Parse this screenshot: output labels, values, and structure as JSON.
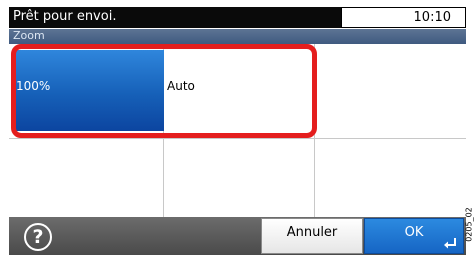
{
  "status": {
    "message": "Prêt pour envoi.",
    "time": "10:10"
  },
  "title": "Zoom",
  "options": [
    {
      "label": "100%",
      "selected": true
    },
    {
      "label": "Auto",
      "selected": false
    }
  ],
  "bottom": {
    "help_icon": "question-circle-icon",
    "help_glyph": "?",
    "cancel_label": "Annuler",
    "ok_label": "OK",
    "ok_icon": "enter-return-icon"
  },
  "side_code": "0205_02",
  "colors": {
    "accent": "#1660b8",
    "highlight": "#e41e1e",
    "status_bg": "#0a0a0a",
    "title_bg": "#4a6488",
    "bottom_bg": "#555555"
  }
}
